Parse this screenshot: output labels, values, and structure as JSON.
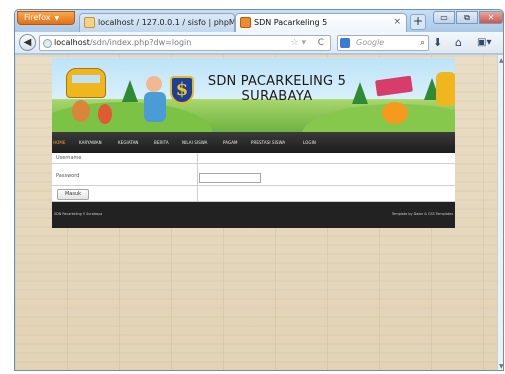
{
  "browser": {
    "app_button_label": "Firefox",
    "tabs": [
      {
        "title": "localhost / 127.0.0.1 / sisfo | phpMyA...",
        "active": false
      },
      {
        "title": "SDN Pacarkeling 5",
        "active": true
      }
    ],
    "tab_close_glyph": "×",
    "new_tab_glyph": "+",
    "window_controls": {
      "minimize": "▭",
      "maximize": "⧉",
      "close": "✕"
    },
    "url": {
      "host": "localhost",
      "path": "/sdn/index.php?dw=login"
    },
    "search_placeholder": "Google",
    "icons": [
      "back-icon",
      "globe-icon",
      "bookmark-star-icon",
      "reload-icon",
      "search-engine-icon",
      "search-icon",
      "download-icon",
      "home-icon",
      "menu-icon"
    ]
  },
  "site": {
    "title_line1": "SDN PACARKELING 5",
    "title_line2": "SURABAYA",
    "logo_glyph": "$",
    "menu": [
      {
        "label": "HOME",
        "active": true
      },
      {
        "label": "KARYAWAN",
        "active": false
      },
      {
        "label": "KEGIATAN",
        "active": false
      },
      {
        "label": "BERITA",
        "active": false
      },
      {
        "label": "NILAI SISWA",
        "active": false
      },
      {
        "label": "PAGAM",
        "active": false
      },
      {
        "label": "PRESTASI SISWA",
        "active": false
      },
      {
        "label": "LOGIN",
        "active": false
      }
    ],
    "login": {
      "username_label": "Username",
      "password_label": "Password",
      "submit_label": "Masuk"
    },
    "footer_left": "SDN Pacarkeling 5 Surabaya",
    "footer_right": "Template by Dawn & CSS Templates"
  },
  "colors": {
    "menu_active": "#f0a428",
    "menu_bar": "#222222",
    "firefox_orange": "#e2701b"
  }
}
